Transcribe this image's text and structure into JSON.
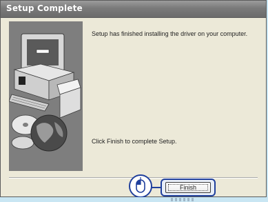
{
  "window": {
    "title": "Setup Complete"
  },
  "content": {
    "top_message": "Setup has finished installing the driver on your computer.",
    "bottom_message": "Click Finish to complete Setup."
  },
  "buttons": {
    "finish_label": "Finish"
  },
  "icons": {
    "illustration": "computer-with-discs-illustration",
    "mouse": "mouse-click-icon"
  },
  "colors": {
    "titlebar": "#7a7a7a",
    "highlight": "#1f3f9c",
    "window_bg": "#ece9d8"
  }
}
